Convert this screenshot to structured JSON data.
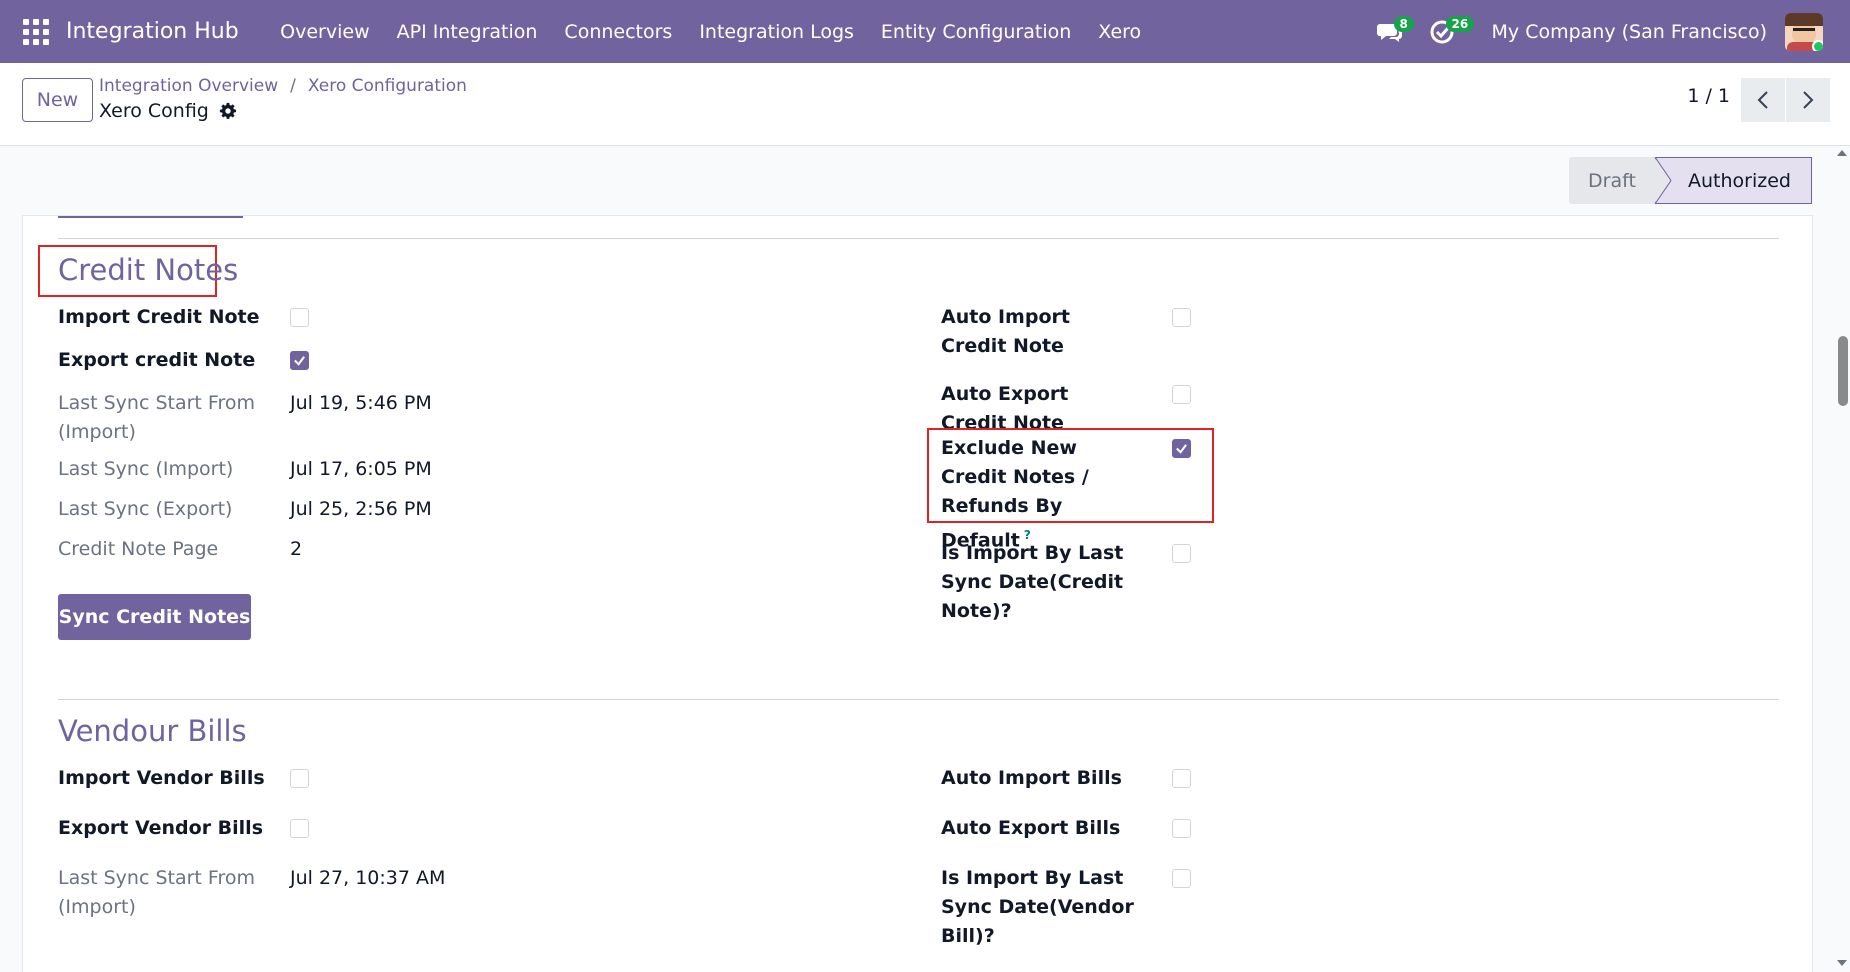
{
  "topnav": {
    "brand": "Integration Hub",
    "menu": [
      "Overview",
      "API Integration",
      "Connectors",
      "Integration Logs",
      "Entity Configuration",
      "Xero"
    ],
    "messages_count": "8",
    "activities_count": "26",
    "company": "My Company (San Francisco)"
  },
  "control": {
    "new_label": "New",
    "breadcrumb": [
      "Integration Overview",
      "Xero Configuration"
    ],
    "breadcrumb_sep": "/",
    "record_title": "Xero Config",
    "pager": "1 / 1"
  },
  "status": {
    "stages": [
      "Draft",
      "Authorized"
    ],
    "current": "Authorized"
  },
  "credit_notes": {
    "title": "Credit Notes",
    "left_fields": [
      {
        "label": "Import Credit Note",
        "type": "checkbox",
        "checked": false
      },
      {
        "label": "Export credit Note",
        "type": "checkbox",
        "checked": true
      },
      {
        "label": "Last Sync Start From (Import)",
        "type": "text",
        "value": "Jul 19, 5:46 PM"
      },
      {
        "label": "Last Sync (Import)",
        "type": "text",
        "value": "Jul 17, 6:05 PM"
      },
      {
        "label": "Last Sync (Export)",
        "type": "text",
        "value": "Jul 25, 2:56 PM"
      },
      {
        "label": "Credit Note Page",
        "type": "text",
        "value": "2"
      }
    ],
    "right_fields": [
      {
        "label": "Auto Import Credit Note",
        "checked": false
      },
      {
        "label": "Auto Export Credit Note",
        "checked": false
      },
      {
        "label": "Exclude New Credit Notes / Refunds By Default",
        "checked": true,
        "help": "?"
      },
      {
        "label": "Is Import By Last Sync Date(Credit Note)?",
        "checked": false
      }
    ],
    "sync_button": "Sync Credit Notes"
  },
  "vendor_bills": {
    "title": "Vendour Bills",
    "left_fields": [
      {
        "label": "Import Vendor Bills",
        "type": "checkbox",
        "checked": false
      },
      {
        "label": "Export Vendor Bills",
        "type": "checkbox",
        "checked": false
      },
      {
        "label": "Last Sync Start From (Import)",
        "type": "text",
        "value": "Jul 27, 10:37 AM"
      }
    ],
    "right_fields": [
      {
        "label": "Auto Import Bills",
        "checked": false
      },
      {
        "label": "Auto Export Bills",
        "checked": false
      },
      {
        "label": "Is Import By Last Sync Date(Vendor Bill)?",
        "checked": false
      }
    ]
  },
  "colors": {
    "brand": "#71639e",
    "highlight": "#e02424",
    "badge": "#17a34a"
  }
}
